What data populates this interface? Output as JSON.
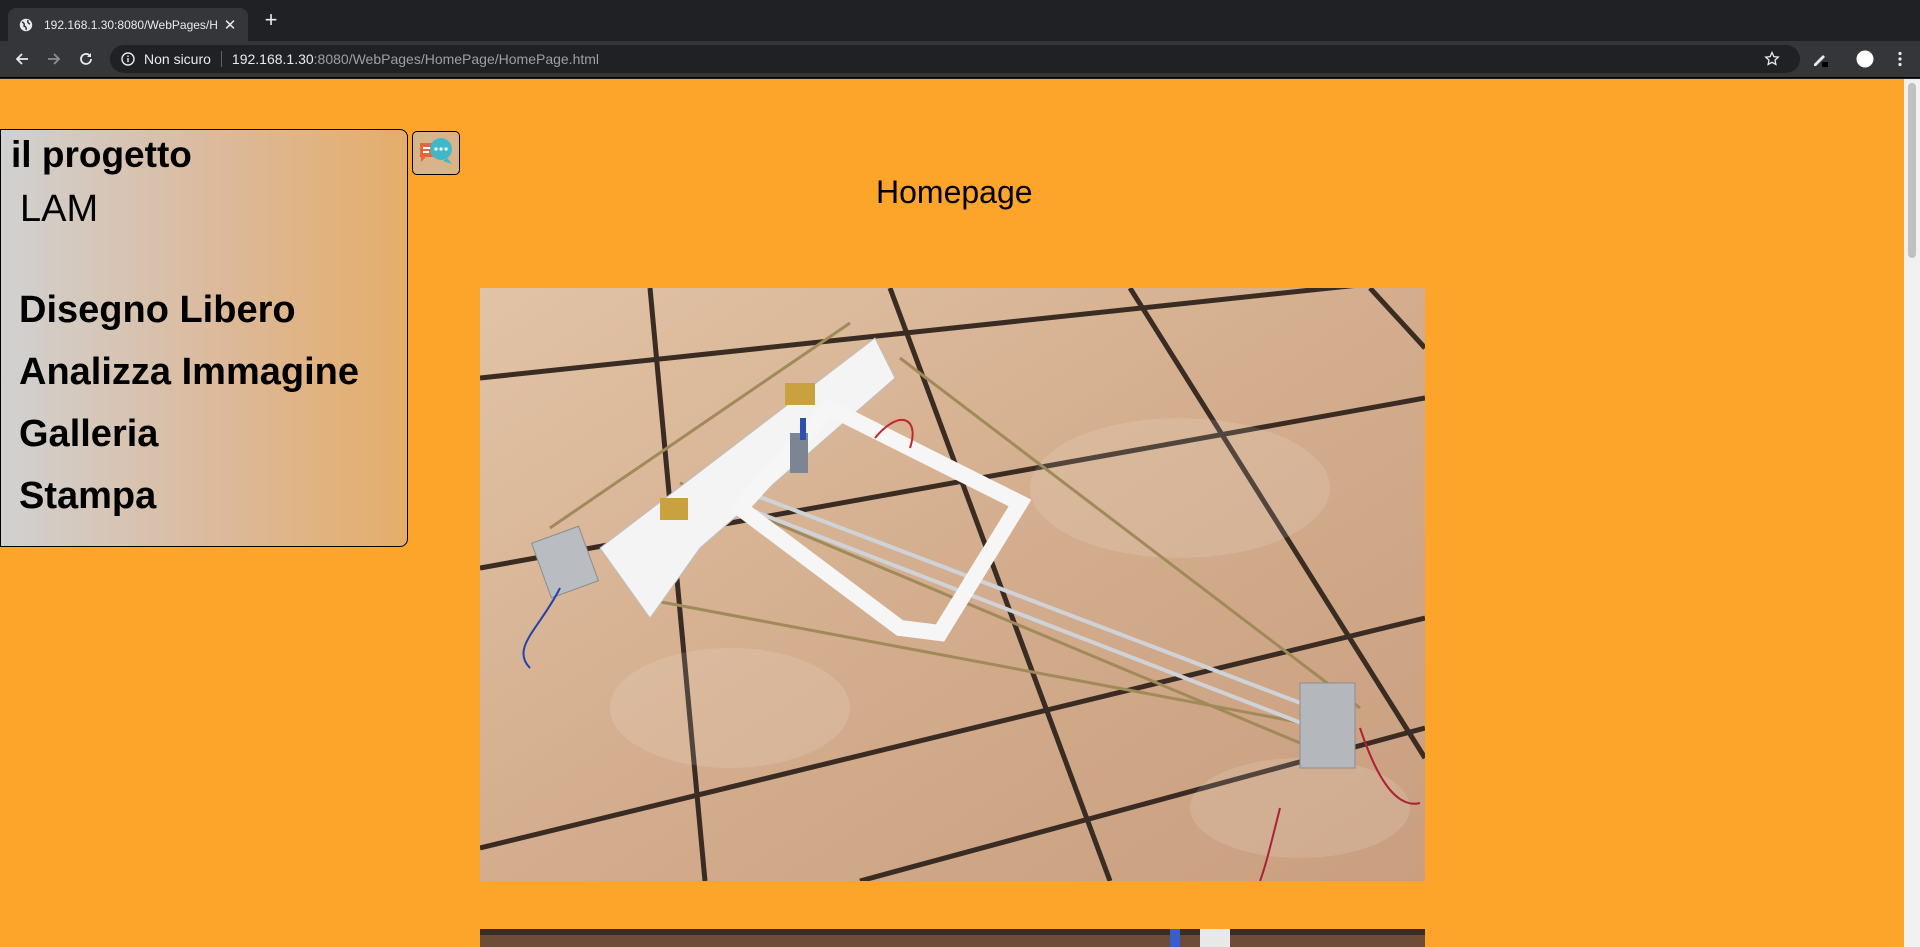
{
  "browser": {
    "tab_title": "192.168.1.30:8080/WebPages/H",
    "security_label": "Non sicuro",
    "url_host": "192.168.1.30",
    "url_rest": ":8080/WebPages/HomePage/HomePage.html"
  },
  "menu": {
    "title": "il progetto",
    "subtitle": "LAM",
    "items": [
      "Disegno Libero",
      "Analizza Immagine",
      "Galleria",
      "Stampa"
    ]
  },
  "page": {
    "heading": "Homepage"
  },
  "colors": {
    "background": "#fda42b",
    "chrome_dark": "#202124",
    "chrome_toolbar": "#35363a"
  },
  "icons": {
    "favicon": "globe-icon",
    "chat": "chat-bubbles-icon"
  }
}
